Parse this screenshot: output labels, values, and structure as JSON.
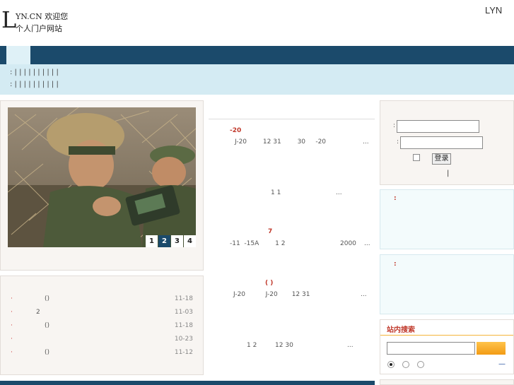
{
  "header": {
    "logo_letter": "L",
    "logo_line1": "YN.CN 欢迎您",
    "logo_line2": "个人门户网站",
    "brand_right": "LYN"
  },
  "subnav": {
    "row1": ":   |   |   |   |   |   |   |   |   |   |",
    "row2": ":   |   |   |   |   |   |   |   |   |   |"
  },
  "slideshow": {
    "pager": [
      "1",
      "2",
      "3",
      "4"
    ],
    "active_index": 1
  },
  "left_list": [
    {
      "bullet": "·",
      "text": "()",
      "date": "11-18"
    },
    {
      "bullet": "·",
      "text": "2",
      "date": "11-03"
    },
    {
      "bullet": "·",
      "text": "()",
      "date": "11-18"
    },
    {
      "bullet": "·",
      "text": "",
      "date": "10-23"
    },
    {
      "bullet": "·",
      "text": "()",
      "date": "11-12"
    }
  ],
  "center": {
    "items": [
      {
        "title": "-20",
        "line1": "J-20        12 31        30     -20",
        "more": "..."
      },
      {
        "title": "",
        "line1": "1 1",
        "more": "..."
      },
      {
        "title": "7",
        "line1": "-11  -15A        1 2",
        "extra": "2000",
        "more": "..."
      },
      {
        "title": "( )",
        "line1": "J-20          J-20       12 31",
        "more": "..."
      },
      {
        "title": "",
        "line1": "1 2         12 30",
        "more": "..."
      }
    ]
  },
  "login": {
    "user_label": ":",
    "pass_label": ":",
    "login_button": "登录",
    "footer_mark": "|"
  },
  "notices": [
    {
      "label": ":"
    },
    {
      "label": ":"
    }
  ],
  "search": {
    "title": "站内搜索",
    "input_value": "",
    "link": "—"
  },
  "colors": {
    "nav": "#1b4a6b",
    "subnav": "#d4ebf3",
    "accent_red": "#c0392b",
    "search_button": "#f29b14"
  }
}
